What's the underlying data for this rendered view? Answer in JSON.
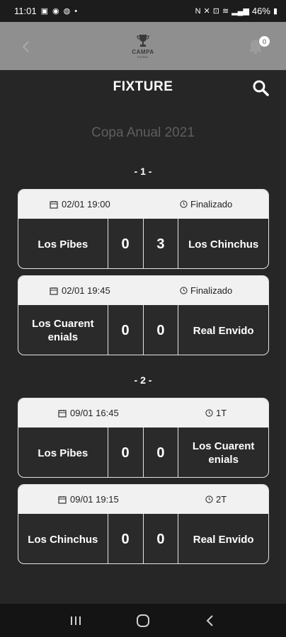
{
  "status_bar": {
    "time": "11:01",
    "battery": "46%"
  },
  "header": {
    "logo_text": "CAMPA",
    "logo_sub": "FUTBOL",
    "notification_count": "0"
  },
  "page": {
    "title": "FIXTURE",
    "tournament": "Copa Anual 2021"
  },
  "rounds": [
    {
      "label": "- 1 -",
      "matches": [
        {
          "date": "02/01 19:00",
          "status": "Finalizado",
          "home": "Los Pibes",
          "home_score": "0",
          "away_score": "3",
          "away": "Los Chinchus"
        },
        {
          "date": "02/01 19:45",
          "status": "Finalizado",
          "home": "Los Cuarent enials",
          "home_score": "0",
          "away_score": "0",
          "away": "Real Envido"
        }
      ]
    },
    {
      "label": "- 2 -",
      "matches": [
        {
          "date": "09/01 16:45",
          "status": "1T",
          "home": "Los Pibes",
          "home_score": "0",
          "away_score": "0",
          "away": "Los Cuarent enials"
        },
        {
          "date": "09/01 19:15",
          "status": "2T",
          "home": "Los Chinchus",
          "home_score": "0",
          "away_score": "0",
          "away": "Real Envido"
        }
      ]
    }
  ],
  "icons": {
    "calendar": "calendar-icon",
    "clock": "clock-icon",
    "search": "search-icon",
    "bell": "bell-icon",
    "back": "chevron-left-icon"
  }
}
